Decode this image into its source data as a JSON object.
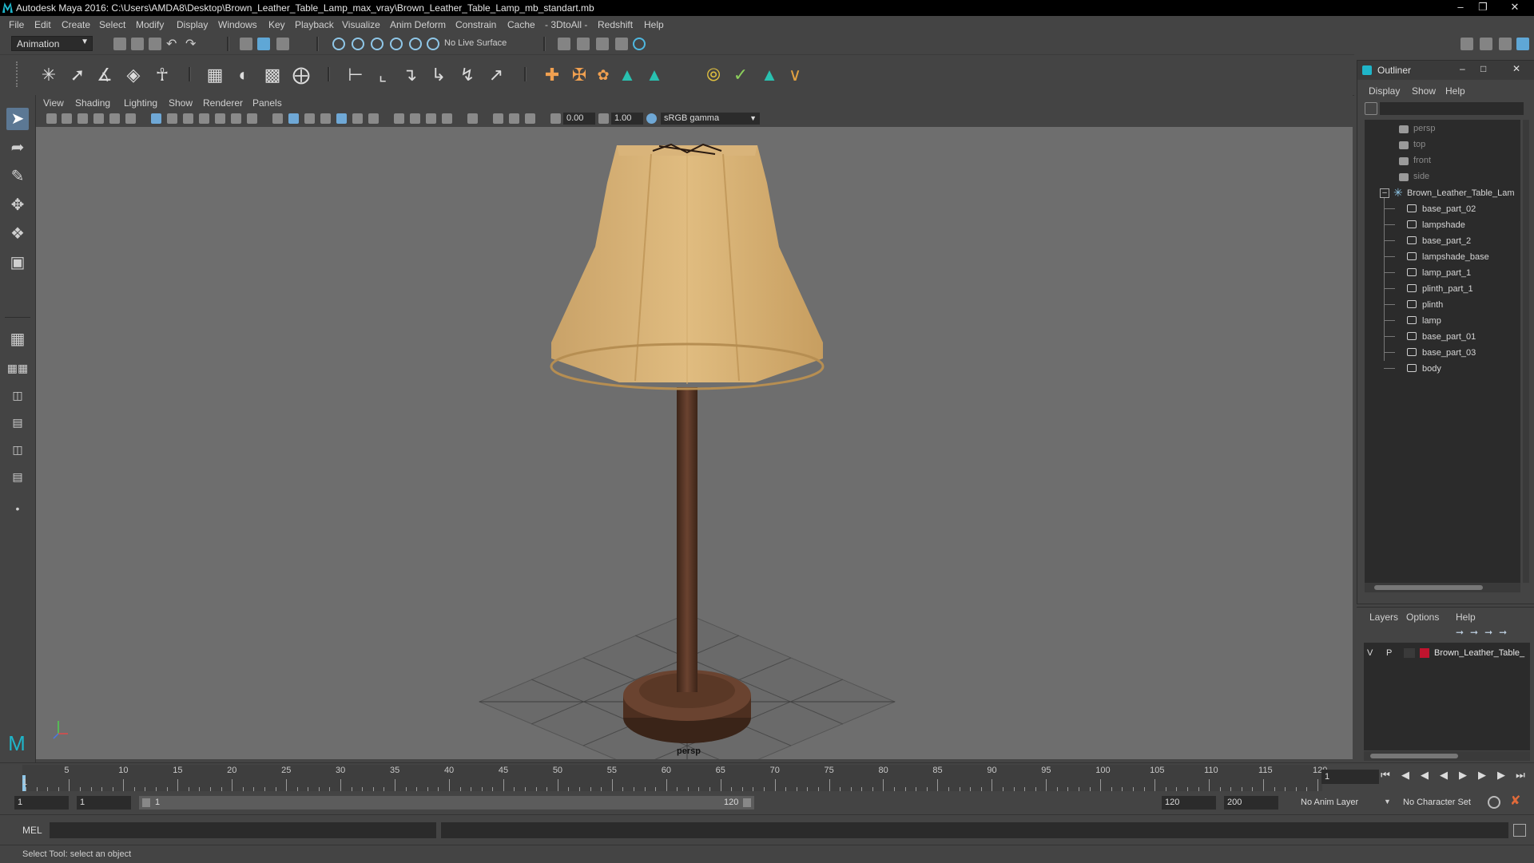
{
  "window": {
    "title": "Autodesk Maya 2016: C:\\Users\\AMDA8\\Desktop\\Brown_Leather_Table_Lamp_max_vray\\Brown_Leather_Table_Lamp_mb_standart.mb"
  },
  "menu": [
    "File",
    "Edit",
    "Create",
    "Select",
    "Modify",
    "Display",
    "Windows",
    "Key",
    "Playback",
    "Visualize",
    "Anim Deform",
    "Constrain",
    "Cache",
    "- 3DtoAll -",
    "Redshift",
    "Help"
  ],
  "shelf": {
    "mode": "Animation",
    "live_surface": "No Live Surface"
  },
  "panel": {
    "menu": [
      "View",
      "Shading",
      "Lighting",
      "Show",
      "Renderer",
      "Panels"
    ],
    "exposure": "0.00",
    "gamma": "1.00",
    "color_space": "sRGB gamma",
    "camera_label": "persp"
  },
  "outliner": {
    "title": "Outliner",
    "menu": [
      "Display",
      "Show",
      "Help"
    ],
    "cameras": [
      "persp",
      "top",
      "front",
      "side"
    ],
    "group": "Brown_Leather_Table_Lam",
    "children": [
      "base_part_02",
      "lampshade",
      "base_part_2",
      "lampshade_base",
      "lamp_part_1",
      "plinth_part_1",
      "plinth",
      "lamp",
      "base_part_01",
      "base_part_03",
      "body"
    ]
  },
  "layers": {
    "menu": [
      "Layers",
      "Options",
      "Help"
    ],
    "row": {
      "v": "V",
      "p": "P",
      "name": "Brown_Leather_Table_",
      "color": "#c0142e"
    }
  },
  "timeline": {
    "ticks": [
      "5",
      "10",
      "15",
      "20",
      "25",
      "30",
      "35",
      "40",
      "45",
      "50",
      "55",
      "60",
      "65",
      "70",
      "75",
      "80",
      "85",
      "90",
      "95",
      "100",
      "105",
      "110",
      "115",
      "120"
    ],
    "start_label": "1",
    "current_frame": "1"
  },
  "range": {
    "start": "1",
    "playback_start": "1",
    "slider_start": "1",
    "slider_end": "120",
    "playback_end": "120",
    "end": "200",
    "anim_layer": "No Anim Layer",
    "character_set": "No Character Set"
  },
  "command": {
    "lang": "MEL"
  },
  "status": {
    "help": "Select Tool: select an object"
  },
  "colors": {
    "accent": "#5c7894",
    "viewport_bg": "#6e6e6e"
  }
}
